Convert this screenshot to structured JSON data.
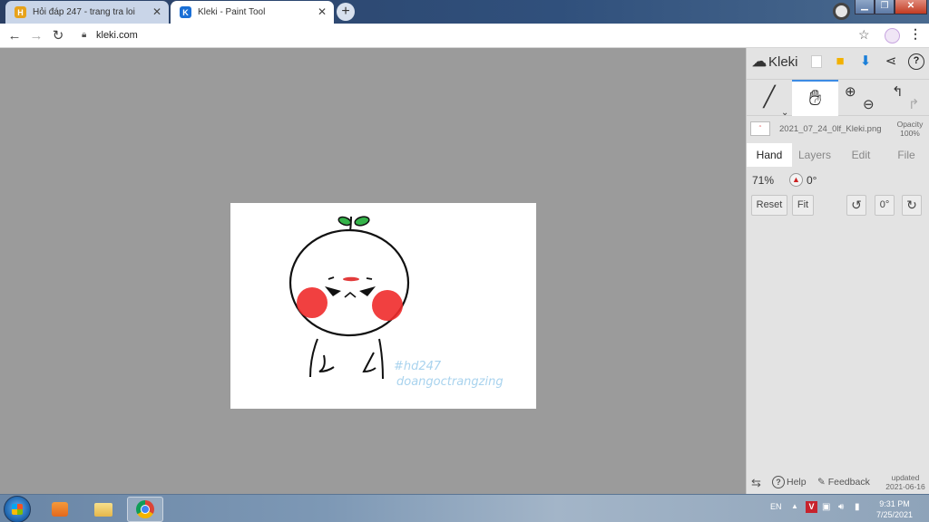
{
  "browser": {
    "tabs": [
      {
        "title": "Hỏi đáp 247 - trang tra loi",
        "favicon": "H"
      },
      {
        "title": "Kleki - Paint Tool",
        "favicon": "K"
      }
    ],
    "address": "kleki.com"
  },
  "canvas": {
    "watermark_line1": "#hd247",
    "watermark_line2": "doangoctrangzing"
  },
  "kleki": {
    "brand": "Kleki",
    "file_name": "2021_07_24_0lf_Kleki.png",
    "opacity_label": "Opacity",
    "opacity_value": "100%",
    "tabs": {
      "hand": "Hand",
      "layers": "Layers",
      "edit": "Edit",
      "file": "File"
    },
    "zoom": "71%",
    "angle": "0°",
    "buttons": {
      "reset": "Reset",
      "fit": "Fit",
      "deg": "0°"
    },
    "footer": {
      "help": "Help",
      "feedback": "Feedback",
      "updated_label": "updated",
      "updated_date": "2021-06-16"
    }
  },
  "taskbar": {
    "lang": "EN",
    "time": "9:31 PM",
    "date": "7/25/2021"
  },
  "colors": {
    "accent": "#3c8be4",
    "workspace": "#9b9b9b",
    "panel": "#e3e3e3"
  }
}
